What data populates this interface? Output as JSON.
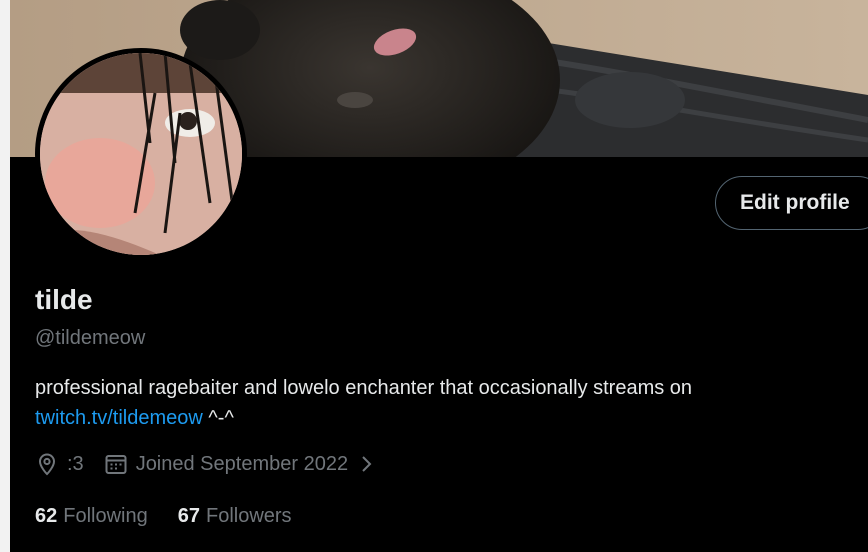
{
  "profile": {
    "display_name": "tilde",
    "handle": "@tildemeow",
    "bio_text": "professional ragebaiter and lowelo enchanter that occasionally streams on",
    "bio_link": "twitch.tv/tildemeow",
    "bio_suffix": "^-^",
    "location": ":3",
    "joined": "Joined September 2022"
  },
  "actions": {
    "edit_profile_label": "Edit profile"
  },
  "stats": {
    "following_count": "62",
    "following_label": "Following",
    "followers_count": "67",
    "followers_label": "Followers"
  },
  "icons": {
    "location": "location-pin-icon",
    "calendar": "calendar-icon",
    "joined_more": "chevron-right-icon"
  },
  "colors": {
    "background": "#000000",
    "primary_text": "#e7e9ea",
    "secondary_text": "#71767b",
    "link": "#1d9bf0",
    "button_border": "#536471"
  }
}
